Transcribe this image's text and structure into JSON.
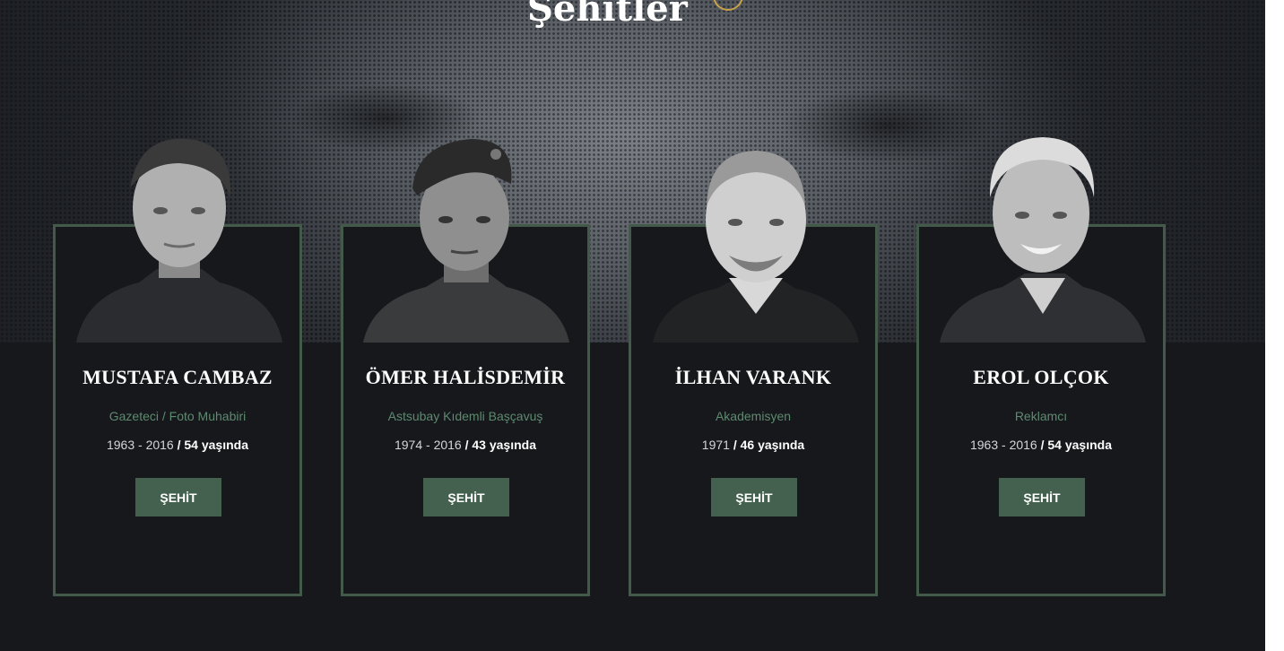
{
  "page_title": "Şehitler",
  "accent_colors": {
    "card_border": "#43594a",
    "button": "#43614e",
    "role_text": "#5e8a70",
    "title_badge": "#c7a24a"
  },
  "cards": [
    {
      "name": "MUSTAFA CAMBAZ",
      "role": "Gazeteci / Foto Muhabiri",
      "years": "1963 - 2016",
      "age": " / 54 yaşında",
      "button": "ŞEHİT"
    },
    {
      "name": "ÖMER HALİSDEMİR",
      "role": "Astsubay Kıdemli Başçavuş",
      "years": "1974 - 2016",
      "age": " / 43 yaşında",
      "button": "ŞEHİT"
    },
    {
      "name": "İLHAN VARANK",
      "role": "Akademisyen",
      "years": "1971",
      "age": " / 46 yaşında",
      "button": "ŞEHİT"
    },
    {
      "name": "EROL OLÇOK",
      "role": "Reklamcı",
      "years": "1963 - 2016",
      "age": " / 54 yaşında",
      "button": "ŞEHİT"
    }
  ]
}
